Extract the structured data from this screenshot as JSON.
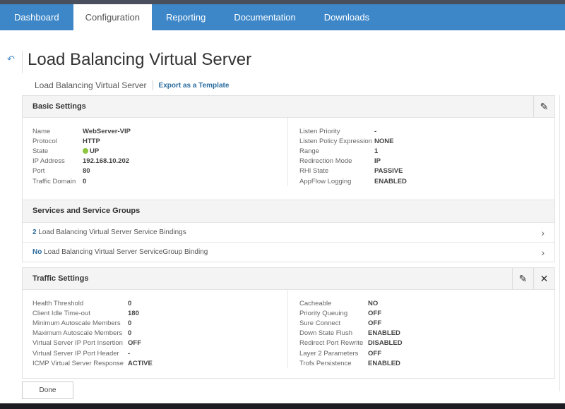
{
  "nav": {
    "tabs": [
      {
        "label": "Dashboard"
      },
      {
        "label": "Configuration",
        "active": true
      },
      {
        "label": "Reporting"
      },
      {
        "label": "Documentation"
      },
      {
        "label": "Downloads"
      }
    ]
  },
  "header": {
    "back_icon": "back-arrow-icon",
    "title": "Load Balancing Virtual Server",
    "breadcrumb": "Load Balancing Virtual Server",
    "export_link": "Export as a Template"
  },
  "basic": {
    "title": "Basic Settings",
    "left": [
      {
        "k": "Name",
        "v": "WebServer-VIP"
      },
      {
        "k": "Protocol",
        "v": "HTTP"
      },
      {
        "k": "State",
        "v": "UP"
      },
      {
        "k": "IP Address",
        "v": "192.168.10.202"
      },
      {
        "k": "Port",
        "v": "80"
      },
      {
        "k": "Traffic Domain",
        "v": "0"
      }
    ],
    "right": [
      {
        "k": "Listen Priority",
        "v": "-"
      },
      {
        "k": "Listen Policy Expression",
        "v": "NONE"
      },
      {
        "k": "Range",
        "v": "1"
      },
      {
        "k": "Redirection Mode",
        "v": "IP"
      },
      {
        "k": "RHI State",
        "v": "PASSIVE"
      },
      {
        "k": "AppFlow Logging",
        "v": "ENABLED"
      }
    ]
  },
  "services": {
    "title": "Services and Service Groups",
    "rows": [
      {
        "count": "2",
        "label": "Load Balancing Virtual Server Service Bindings"
      },
      {
        "count": "No",
        "label": "Load Balancing Virtual Server ServiceGroup Binding"
      }
    ]
  },
  "traffic": {
    "title": "Traffic Settings",
    "left": [
      {
        "k": "Health Threshold",
        "v": "0"
      },
      {
        "k": "Client Idle Time-out",
        "v": "180"
      },
      {
        "k": "Minimum Autoscale Members",
        "v": "0"
      },
      {
        "k": "Maximum Autoscale Members",
        "v": "0"
      },
      {
        "k": "Virtual Server IP Port Insertion",
        "v": "OFF"
      },
      {
        "k": "Virtual Server IP Port Header",
        "v": "-"
      },
      {
        "k": "ICMP Virtual Server Response",
        "v": "ACTIVE"
      }
    ],
    "right": [
      {
        "k": "Cacheable",
        "v": "NO"
      },
      {
        "k": "Priority Queuing",
        "v": "OFF"
      },
      {
        "k": "Sure Connect",
        "v": "OFF"
      },
      {
        "k": "Down State Flush",
        "v": "ENABLED"
      },
      {
        "k": "Redirect Port Rewrite",
        "v": "DISABLED"
      },
      {
        "k": "Layer 2 Parameters",
        "v": "OFF"
      },
      {
        "k": "Trofs Persistence",
        "v": "ENABLED"
      }
    ]
  },
  "done_label": "Done",
  "colors": {
    "nav": "#3d87c8",
    "status_up": "#8cc63f",
    "link": "#2a6c9e"
  }
}
